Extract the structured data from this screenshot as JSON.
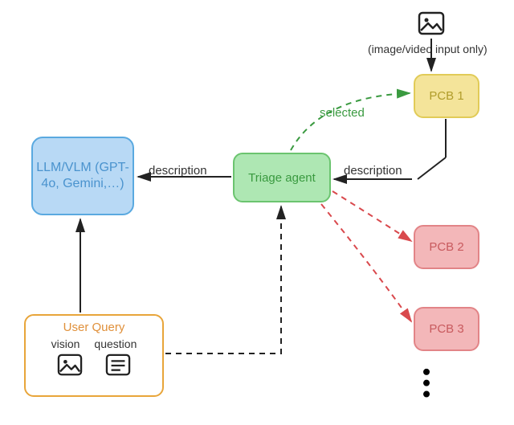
{
  "top_icon_note": "(image/video input only)",
  "llm_box": "LLM/VLM (GPT-4o, Gemini,…)",
  "triage_box": "Triage agent",
  "pcb1": "PCB 1",
  "pcb2": "PCB 2",
  "pcb3": "PCB 3",
  "user_query": {
    "title": "User Query",
    "vision": "vision",
    "question": "question"
  },
  "edge_labels": {
    "description_left": "description",
    "description_right": "description",
    "selected": "selected"
  },
  "colors": {
    "llm_bg": "#b8d9f5",
    "triage_bg": "#aee7b3",
    "pcb_selected_bg": "#f4e49a",
    "pcb_unselected_bg": "#f3b7b9",
    "user_query_border": "#e8a53a",
    "selected_arrow": "#3a9a40",
    "unselected_arrow": "#d9494d"
  }
}
